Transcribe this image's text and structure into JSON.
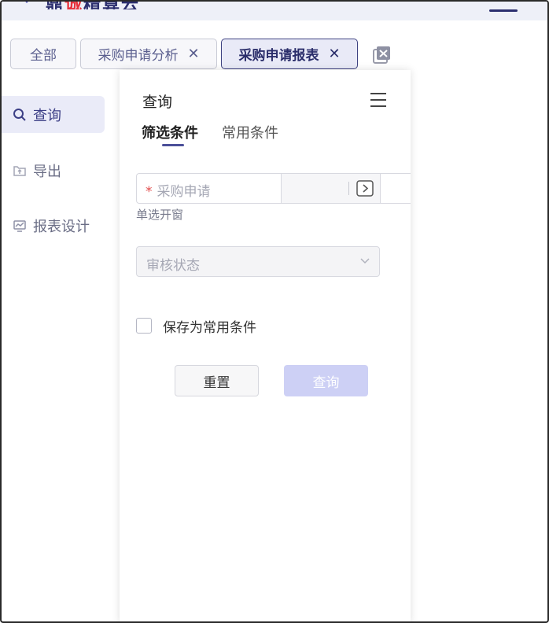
{
  "header": {
    "logo_text_a": "鼎",
    "logo_text_accent": "诚",
    "logo_text_b": "精算云"
  },
  "tabs": [
    {
      "label": "全部",
      "closable": false,
      "active": false
    },
    {
      "label": "采购申请分析",
      "closable": true,
      "active": false
    },
    {
      "label": "采购申请报表",
      "closable": true,
      "active": true
    }
  ],
  "tab_close_glyph": "✕",
  "sidebar": {
    "items": [
      {
        "label": "查询",
        "icon": "search-icon",
        "active": true
      },
      {
        "label": "导出",
        "icon": "export-icon",
        "active": false
      },
      {
        "label": "报表设计",
        "icon": "report-design-icon",
        "active": false
      }
    ]
  },
  "panel": {
    "title": "查询",
    "subtabs": [
      {
        "label": "筛选条件",
        "active": true
      },
      {
        "label": "常用条件",
        "active": false
      }
    ],
    "field": {
      "required_mark": "*",
      "placeholder": "采购申请",
      "hint": "单选开窗"
    },
    "select": {
      "placeholder": "审核状态"
    },
    "checkbox_label": "保存为常用条件",
    "reset_label": "重置",
    "query_label": "查询"
  },
  "colors": {
    "accent": "#3f4382",
    "required": "#e24c4c",
    "query_button_disabled": "#cdd0f5"
  }
}
